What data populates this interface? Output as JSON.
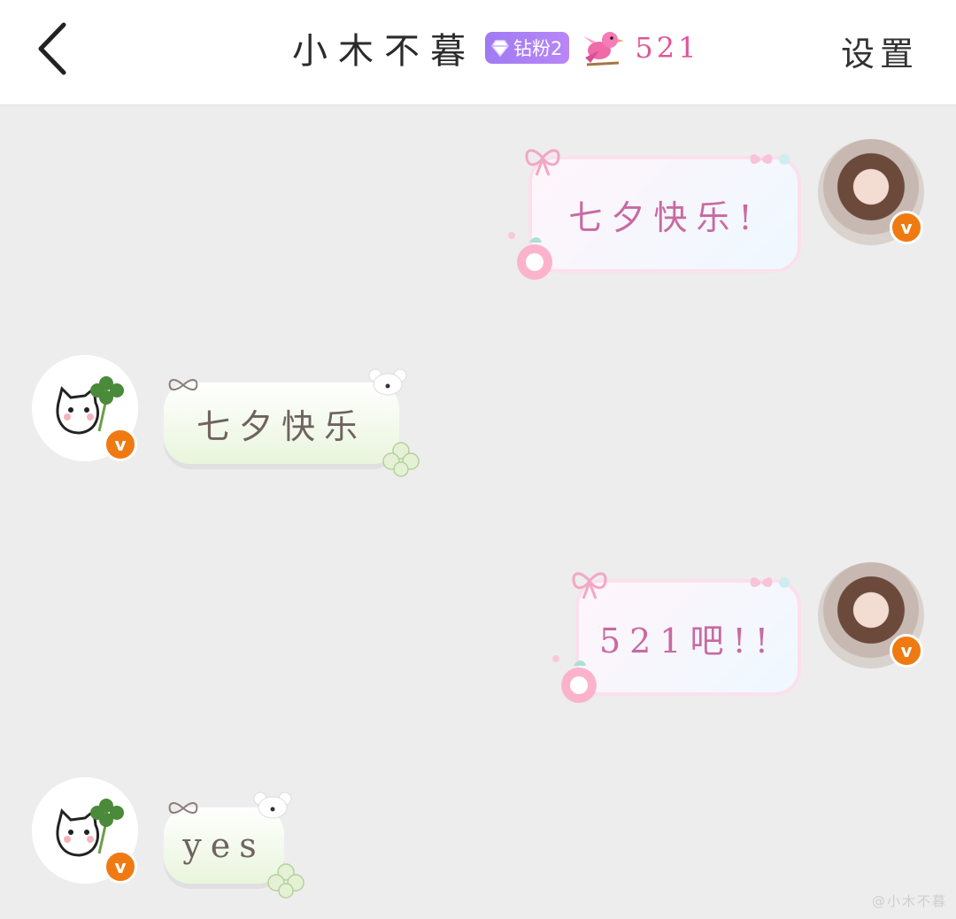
{
  "header": {
    "title": "小木不暮",
    "fan_badge": "钻粉2",
    "fan_number": "521",
    "settings_label": "设置"
  },
  "messages": [
    {
      "side": "right",
      "text": "七夕快乐!"
    },
    {
      "side": "left",
      "text": "七夕快乐"
    },
    {
      "side": "right",
      "text": "521吧!!"
    },
    {
      "side": "left",
      "text": "yes"
    }
  ],
  "watermark": "@小木不暮",
  "colors": {
    "page_bg": "#ededed",
    "header_bg": "#ffffff",
    "badge_purple": "#a87ff5",
    "pink_text": "#c86aa2",
    "verified_orange": "#f07a12"
  }
}
